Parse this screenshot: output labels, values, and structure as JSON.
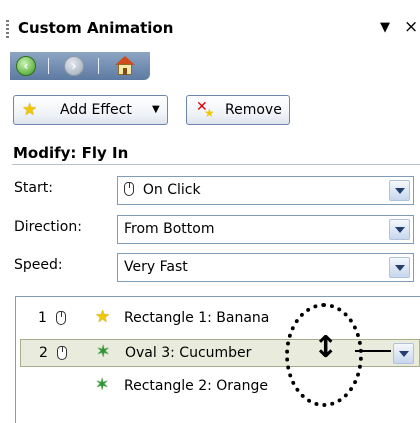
{
  "pane": {
    "title": "Custom Animation",
    "menu_glyph": "▼",
    "close_glyph": "×"
  },
  "nav": {
    "back_icon": "back-arrow-icon",
    "forward_icon": "forward-arrow-icon",
    "home_icon": "home-icon"
  },
  "toolbar": {
    "add_effect_label": "Add Effect",
    "remove_label": "Remove"
  },
  "modify": {
    "label": "Modify: Fly In",
    "fields": [
      {
        "label": "Start:",
        "value": "On Click"
      },
      {
        "label": "Direction:",
        "value": "From Bottom"
      },
      {
        "label": "Speed:",
        "value": "Very Fast"
      }
    ]
  },
  "effects_list": {
    "items": [
      {
        "number": "1",
        "name": "Rectangle 1: Banana",
        "effect_icon": "star-icon"
      },
      {
        "number": "2",
        "name": "Oval 3: Cucumber",
        "effect_icon": "fly-in-icon",
        "selected": true
      },
      {
        "number": "",
        "name": "Rectangle 2: Orange",
        "effect_icon": "fly-in-icon"
      }
    ]
  },
  "colors": {
    "nav_bar": "#5d7aa2",
    "selected_row": "#e9ecdc",
    "combo_border": "#7f9db9"
  }
}
